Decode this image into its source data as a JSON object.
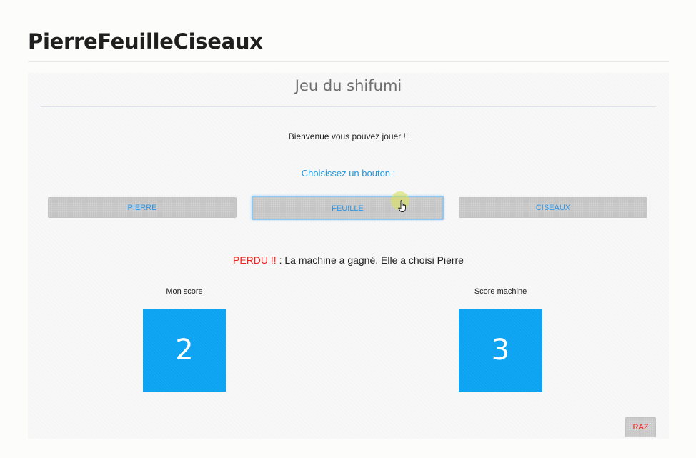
{
  "page": {
    "title": "PierreFeuilleCiseaux"
  },
  "game": {
    "title": "Jeu du shifumi",
    "welcome": "Bienvenue vous pouvez jouer !!",
    "choose_prompt": "Choisissez un bouton :",
    "choices": {
      "pierre": "PIERRE",
      "feuille": "FEUILLE",
      "ciseaux": "CISEAUX"
    },
    "selected_choice": "feuille",
    "result": {
      "status": "PERDU !!",
      "message": " : La machine a gagné. Elle a choisi Pierre"
    },
    "scores": {
      "mine_label": "Mon score",
      "mine_value": "2",
      "machine_label": "Score machine",
      "machine_value": "3"
    },
    "reset_label": "RAZ"
  },
  "colors": {
    "accent_blue": "#0ba3f2",
    "link_blue": "#1e9be0",
    "lost_red": "#f0201a",
    "button_gray": "#c6c6c6"
  },
  "icons": {
    "cursor": "hand-pointer-icon"
  }
}
